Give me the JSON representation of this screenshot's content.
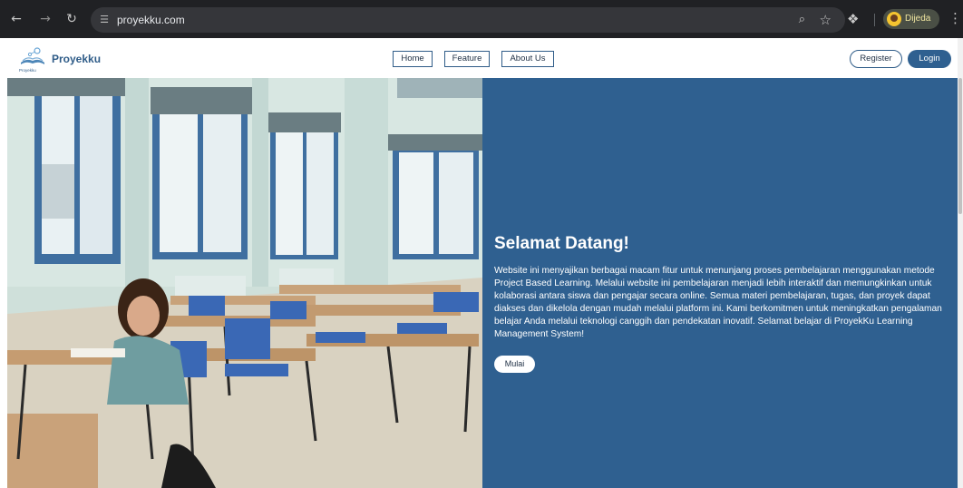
{
  "browser": {
    "url": "proyekku.com",
    "profile_name": "Dijeda",
    "icons": [
      "back-arrow-icon",
      "forward-arrow-icon",
      "reload-icon",
      "site-settings-icon",
      "zoom-icon",
      "star-icon",
      "extensions-icon",
      "profile-avatar-icon",
      "kebab-menu-icon"
    ]
  },
  "header": {
    "brand": "Proyekku",
    "logo_caption": "Proyekku",
    "nav": {
      "home": "Home",
      "feature": "Feature",
      "about": "About Us"
    },
    "register": "Register",
    "login": "Login"
  },
  "hero": {
    "title": "Selamat Datang!",
    "description": "Website ini menyajikan berbagai macam fitur untuk menunjang proses pembelajaran menggunakan metode Project Based Learning. Melalui website ini pembelajaran menjadi lebih interaktif dan memungkinkan untuk kolaborasi antara siswa dan pengajar secara online. Semua materi pembelajaran, tugas, dan proyek dapat diakses dan dikelola dengan mudah melalui platform ini. Kami berkomitmen untuk meningkatkan pengalaman belajar Anda melalui teknologi canggih dan pendekatan inovatif. Selamat belajar di ProyekKu Learning Management System!",
    "cta": "Mulai",
    "image": "classroom-photo"
  },
  "colors": {
    "accent": "#2f6090",
    "chrome_bg": "#202124",
    "omnibox_bg": "#35363a"
  }
}
